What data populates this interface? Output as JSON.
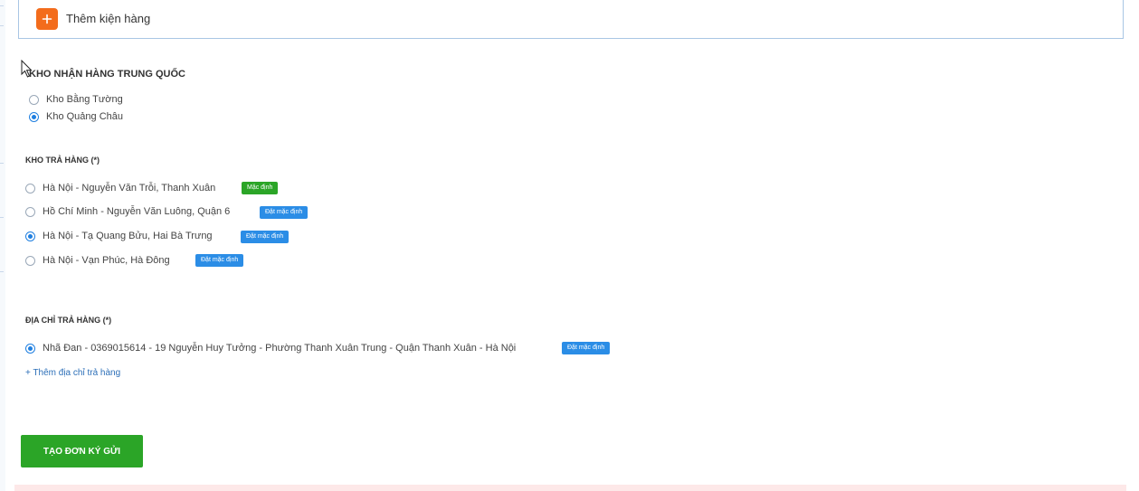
{
  "add_package": {
    "label": "Thêm kiện hàng",
    "icon": "plus-icon",
    "accent_color": "#f36c1c"
  },
  "china_warehouse": {
    "title": "KHO NHẬN HÀNG TRUNG QUỐC",
    "options": [
      {
        "label": "Kho Bằng Tường",
        "selected": false
      },
      {
        "label": "Kho Quảng Châu",
        "selected": true
      }
    ]
  },
  "return_warehouse": {
    "title": "KHO TRẢ HÀNG (*)",
    "options": [
      {
        "label": "Hà Nội - Nguyễn Văn Trỗi, Thanh Xuân",
        "selected": false,
        "badge": "Mặc định",
        "badge_type": "default"
      },
      {
        "label": "Hồ Chí Minh - Nguyễn Văn Luông, Quận 6",
        "selected": false,
        "badge": "Đặt mặc định",
        "badge_type": "action"
      },
      {
        "label": "Hà Nội - Tạ Quang Bửu, Hai Bà Trưng",
        "selected": true,
        "badge": "Đặt mặc định",
        "badge_type": "action"
      },
      {
        "label": "Hà Nội - Vạn Phúc, Hà Đông",
        "selected": false,
        "badge": "Đặt mặc định",
        "badge_type": "action"
      }
    ]
  },
  "return_address": {
    "title": "ĐỊA CHỈ TRẢ HÀNG (*)",
    "options": [
      {
        "label": "Nhã Đan - 0369015614 - 19 Nguyễn Huy Tưởng - Phường Thanh Xuân Trung - Quận Thanh Xuân - Hà Nội",
        "selected": true,
        "badge": "Đặt mặc định"
      }
    ],
    "add_link": "+ Thêm địa chỉ trả hàng"
  },
  "submit": {
    "label": "TẠO ĐƠN KÝ GỬI"
  },
  "colors": {
    "primary_green": "#2ba527",
    "badge_blue": "#2b8de6",
    "radio_blue": "#1f7fe0",
    "link_blue": "#2c6fb8"
  }
}
